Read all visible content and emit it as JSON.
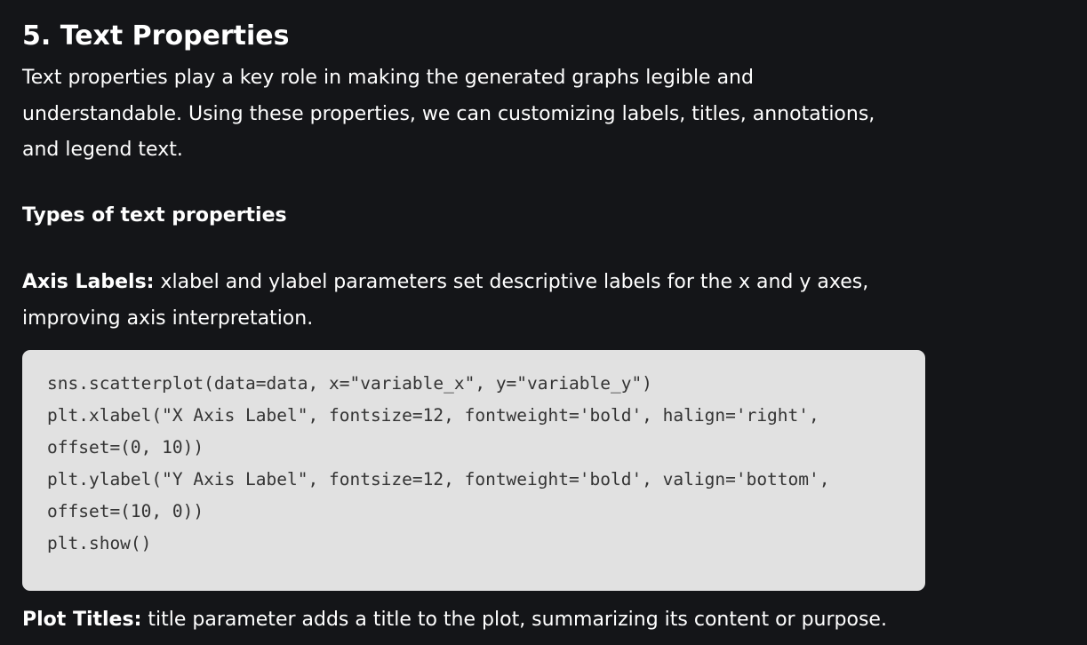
{
  "section": {
    "heading": "5. Text Properties",
    "intro": "Text properties play a key role in making the generated graphs legible and understandable. Using these properties, we can customizing labels, titles, annotations, and legend text.",
    "subheading": "Types of text properties"
  },
  "axis_labels": {
    "term": "Axis Labels:",
    "text": " xlabel and ylabel parameters set descriptive labels for the x and y axes, improving axis interpretation."
  },
  "code": {
    "lines": [
      "sns.scatterplot(data=data, x=\"variable_x\", y=\"variable_y\")",
      "plt.xlabel(\"X Axis Label\", fontsize=12, fontweight='bold', halign='right',",
      "offset=(0, 10))",
      "plt.ylabel(\"Y Axis Label\", fontsize=12, fontweight='bold', valign='bottom',",
      "offset=(10, 0))",
      "plt.show()"
    ]
  },
  "plot_titles": {
    "term": "Plot Titles:",
    "text": " title parameter adds a title to the plot, summarizing its content or purpose."
  },
  "colors": {
    "page_background": "#141518",
    "text": "#ffffff",
    "code_background": "#e1e1e1",
    "code_text": "#333333"
  }
}
